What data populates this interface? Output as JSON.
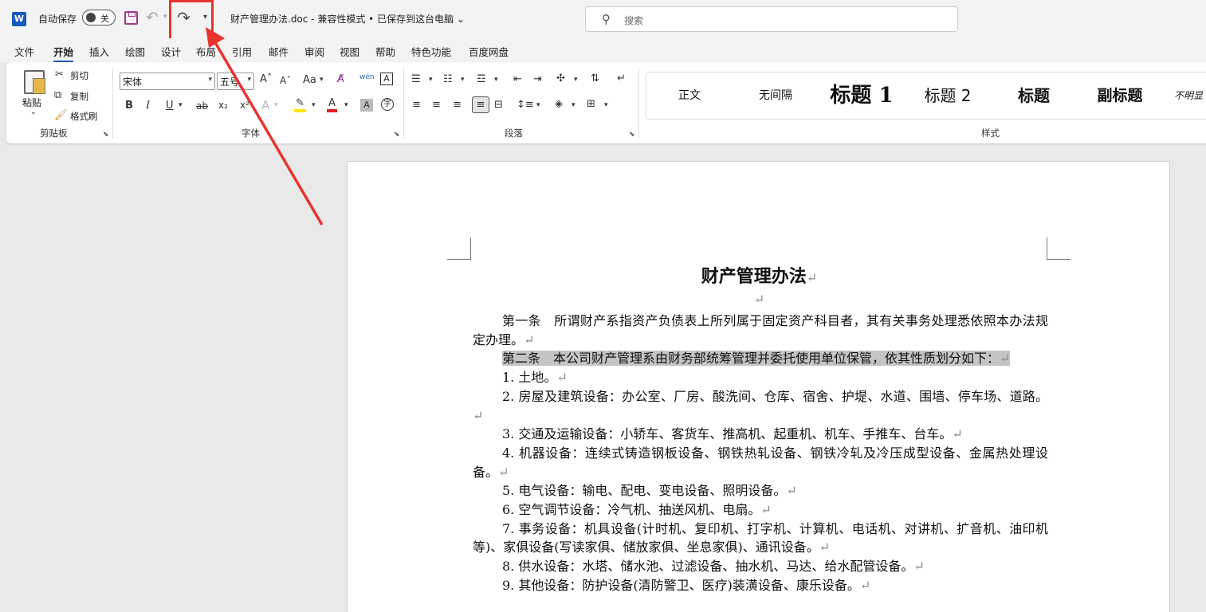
{
  "titlebar": {
    "app_logo": "W",
    "autosave_label": "自动保存",
    "autosave_state": "关",
    "doc_title": "财产管理办法.doc  -  兼容性模式 • 已保存到这台电脑",
    "search_placeholder": "搜索",
    "icons": [
      "word-logo-icon",
      "save-icon",
      "undo-icon",
      "redo-icon",
      "customize-quick-access-icon",
      "search-icon"
    ]
  },
  "menu": {
    "tabs": [
      "文件",
      "开始",
      "插入",
      "绘图",
      "设计",
      "布局",
      "引用",
      "邮件",
      "审阅",
      "视图",
      "帮助",
      "特色功能",
      "百度网盘"
    ],
    "active": "开始"
  },
  "ribbon": {
    "clipboard": {
      "paste": "粘贴",
      "cut": "剪切",
      "copy": "复制",
      "format_painter": "格式刷",
      "label": "剪贴板"
    },
    "font": {
      "font_name": "宋体",
      "font_size": "五号",
      "bold": "B",
      "italic": "I",
      "underline": "U",
      "strike": "ab",
      "subscript": "x₂",
      "superscript": "x²",
      "grow": "A^",
      "shrink": "Aˇ",
      "change_case": "Aa",
      "phonetic": "wén",
      "label": "字体"
    },
    "paragraph": {
      "label": "段落"
    },
    "styles": {
      "items": [
        "正文",
        "无间隔",
        "标题 1",
        "标题 2",
        "标题",
        "副标题",
        "不明显"
      ],
      "label": "样式"
    }
  },
  "document": {
    "title": "财产管理办法",
    "paragraphs": [
      "第一条　所谓财产系指资产负债表上所列属于固定资产科目者，其有关事务处理悉依照本办法规定办理。",
      "第二条　本公司财产管理系由财务部统筹管理并委托使用单位保管，依其性质划分如下：",
      "1. 土地。",
      "2. 房屋及建筑设备：办公室、厂房、酸洗间、仓库、宿舍、护堤、水道、围墙、停车场、道路。",
      "3. 交通及运输设备：小轿车、客货车、推高机、起重机、机车、手推车、台车。",
      "4. 机器设备：连续式铸造钢板设备、钢铁热轧设备、钢铁冷轧及冷压成型设备、金属热处理设备。",
      "5. 电气设备：输电、配电、变电设备、照明设备。",
      "6. 空气调节设备：冷气机、抽送风机、电扇。",
      "7. 事务设备：机具设备(计时机、复印机、打字机、计算机、电话机、对讲机、扩音机、油印机等)、家俱设备(写读家俱、储放家俱、坐息家俱)、通讯设备。",
      "8. 供水设备：水塔、储水池、过滤设备、抽水机、马达、给水配管设备。",
      "9. 其他设备：防护设备(清防警卫、医疗)装潢设备、康乐设备。"
    ],
    "highlighted_paragraph_index": 1
  },
  "colors": {
    "accent": "#185abd",
    "annotation": "#e8342e",
    "highlight": "#c4c4c4"
  }
}
